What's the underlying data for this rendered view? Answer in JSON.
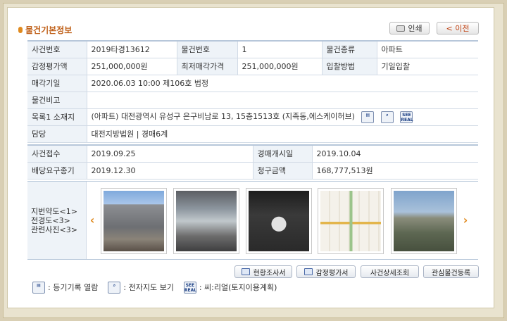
{
  "header": {
    "title": "물건기본정보"
  },
  "toolbar": {
    "print_label": "인쇄",
    "prev_label": "< 이전"
  },
  "info": {
    "case_no_label": "사건번호",
    "case_no": "2019타경13612",
    "item_no_label": "물건번호",
    "item_no": "1",
    "item_type_label": "물건종류",
    "item_type": "아파트",
    "appraisal_label": "감정평가액",
    "appraisal": "251,000,000원",
    "min_price_label": "최저매각가격",
    "min_price": "251,000,000원",
    "bid_method_label": "입찰방법",
    "bid_method": "기일입찰",
    "sale_date_label": "매각기일",
    "sale_date": "2020.06.03 10:00 제106호 법정",
    "remark_label": "물건비고",
    "remark": "",
    "location_label": "목록1 소재지",
    "location": "(아파트) 대전광역시 유성구 은구비남로 13, 15층1513호 (지족동,에스케이허브)",
    "court_label": "담당",
    "court": "대전지방법원 | 경매6계"
  },
  "case": {
    "received_label": "사건접수",
    "received": "2019.09.25",
    "start_label": "경매개시일",
    "start": "2019.10.04",
    "deadline_label": "배당요구종기",
    "deadline": "2019.12.30",
    "claim_label": "청구금액",
    "claim": "168,777,513원"
  },
  "photos": {
    "label_lines": [
      "지번약도<1>",
      "전경도<3>",
      "관련사진<3>"
    ],
    "prev_icon": "chevron-left-icon",
    "next_icon": "chevron-right-icon"
  },
  "buttons": {
    "status": "현황조사서",
    "appraisal_doc": "감정평가서",
    "case_detail": "사건상세조회",
    "interest": "관심물건등록"
  },
  "legend": {
    "registry": ": 등기기록 열람",
    "emap": ": 전자지도 보기",
    "seereal": ": 씨:리얼(토지이용계획)",
    "see_top": "SEE",
    "see_bottom": "REAL"
  },
  "colors": {
    "accent": "#c0611a",
    "label_bg": "#eef3f8",
    "border": "#b7c7da"
  }
}
